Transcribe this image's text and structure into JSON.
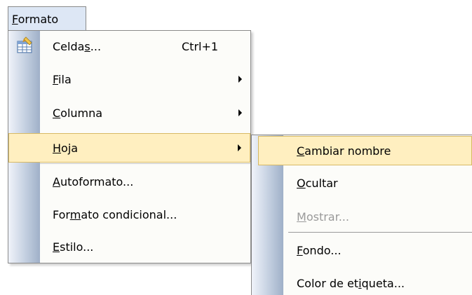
{
  "menubar": {
    "formato": {
      "pre": "",
      "mnemonic": "F",
      "post": "ormato"
    }
  },
  "menu": {
    "items": [
      {
        "pre": "Celda",
        "mnemonic": "s",
        "post": "...",
        "shortcut": "Ctrl+1",
        "icon": "format-cells-icon"
      },
      {
        "pre": "",
        "mnemonic": "F",
        "post": "ila",
        "submenu": true
      },
      {
        "pre": "",
        "mnemonic": "C",
        "post": "olumna",
        "submenu": true
      },
      {
        "pre": "",
        "mnemonic": "H",
        "post": "oja",
        "submenu": true,
        "highlighted": true
      },
      {
        "pre": "",
        "mnemonic": "A",
        "post": "utoformato..."
      },
      {
        "pre": "For",
        "mnemonic": "m",
        "post": "ato condicional..."
      },
      {
        "pre": "",
        "mnemonic": "E",
        "post": "stilo..."
      }
    ]
  },
  "submenu": {
    "items": [
      {
        "pre": "",
        "mnemonic": "C",
        "post": "ambiar nombre",
        "highlighted": true
      },
      {
        "pre": "",
        "mnemonic": "O",
        "post": "cultar"
      },
      {
        "pre": "",
        "mnemonic": "M",
        "post": "ostrar...",
        "disabled": true
      },
      {
        "pre": "",
        "mnemonic": "F",
        "post": "ondo..."
      },
      {
        "pre": "Color de et",
        "mnemonic": "i",
        "post": "queta..."
      }
    ]
  },
  "colors": {
    "highlight": "#ffefc0",
    "highlight_border": "#d7b964",
    "menubar_active": "#dde7f5",
    "disabled_text": "#9a9a9a"
  }
}
